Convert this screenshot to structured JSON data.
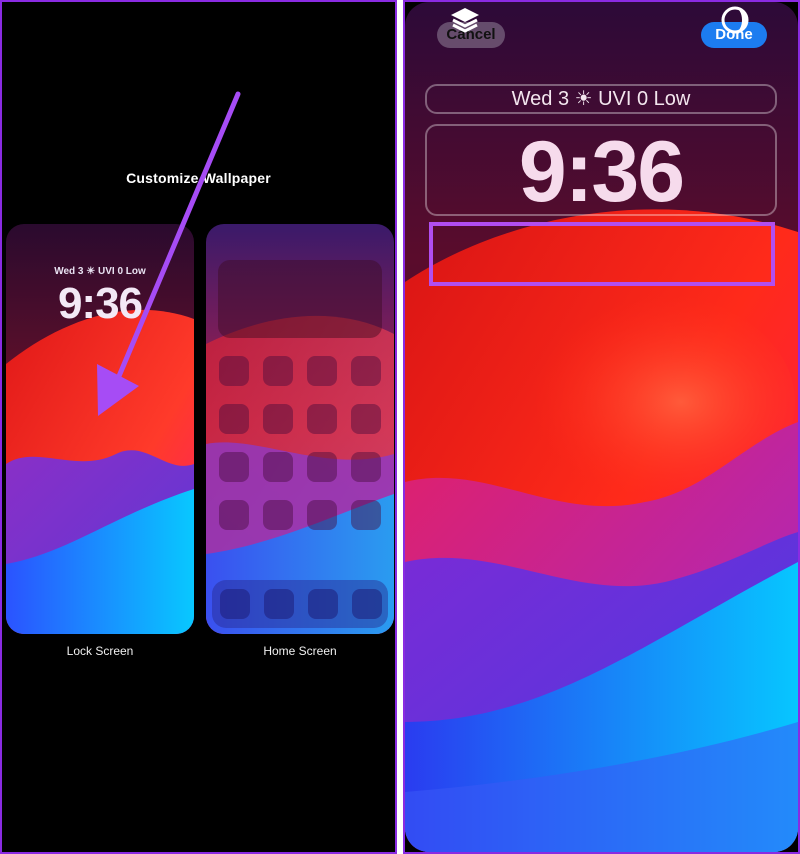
{
  "left": {
    "title": "Customize Wallpaper",
    "lock": {
      "date_line": "Wed 3 ☀ UVI 0 Low",
      "time": "9:36",
      "label": "Lock Screen"
    },
    "home": {
      "label": "Home Screen"
    }
  },
  "right": {
    "cancel": "Cancel",
    "done": "Done",
    "date_line": "Wed 3 ☀ UVI 0 Low",
    "time": "9:36"
  },
  "colors": {
    "accent": "#8a2be2",
    "done_blue": "#1c7cf0",
    "highlight": "#b14ef0"
  },
  "icons": [
    "arrow-annotation-icon",
    "layers-icon",
    "color-filter-icon"
  ]
}
